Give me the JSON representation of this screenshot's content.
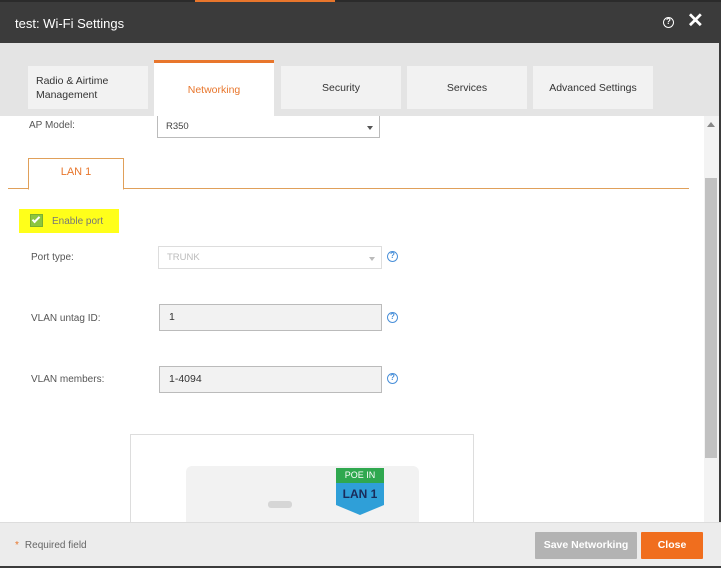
{
  "window": {
    "title": "test: Wi-Fi Settings",
    "help_icon": "help-circle-icon",
    "close_icon": "close-x-icon"
  },
  "tabs": [
    {
      "label": "Radio & Airtime Management",
      "active": false
    },
    {
      "label": "Networking",
      "active": true
    },
    {
      "label": "Security",
      "active": false
    },
    {
      "label": "Services",
      "active": false
    },
    {
      "label": "Advanced Settings",
      "active": false
    }
  ],
  "form": {
    "ap_model_label": "AP Model:",
    "ap_model_value": "R350",
    "lan_tab_label": "LAN 1",
    "enable_port_label": "Enable port",
    "enable_port_checked": true,
    "port_type_label": "Port type:",
    "port_type_value": "TRUNK",
    "vlan_untag_label": "VLAN untag ID:",
    "vlan_untag_value": "1",
    "vlan_members_label": "VLAN members:",
    "vlan_members_value": "1-4094"
  },
  "device_image": {
    "poe_label": "POE IN",
    "lan_label": "LAN 1"
  },
  "footer": {
    "required_star": "*",
    "required_text": "Required field",
    "save_button": "Save Networking",
    "close_button": "Close"
  },
  "colors": {
    "accent": "#e8762c",
    "highlight": "#ffff1a",
    "checkbox": "#8dc63f",
    "info": "#4a90d9",
    "close_button": "#f06e1e"
  }
}
